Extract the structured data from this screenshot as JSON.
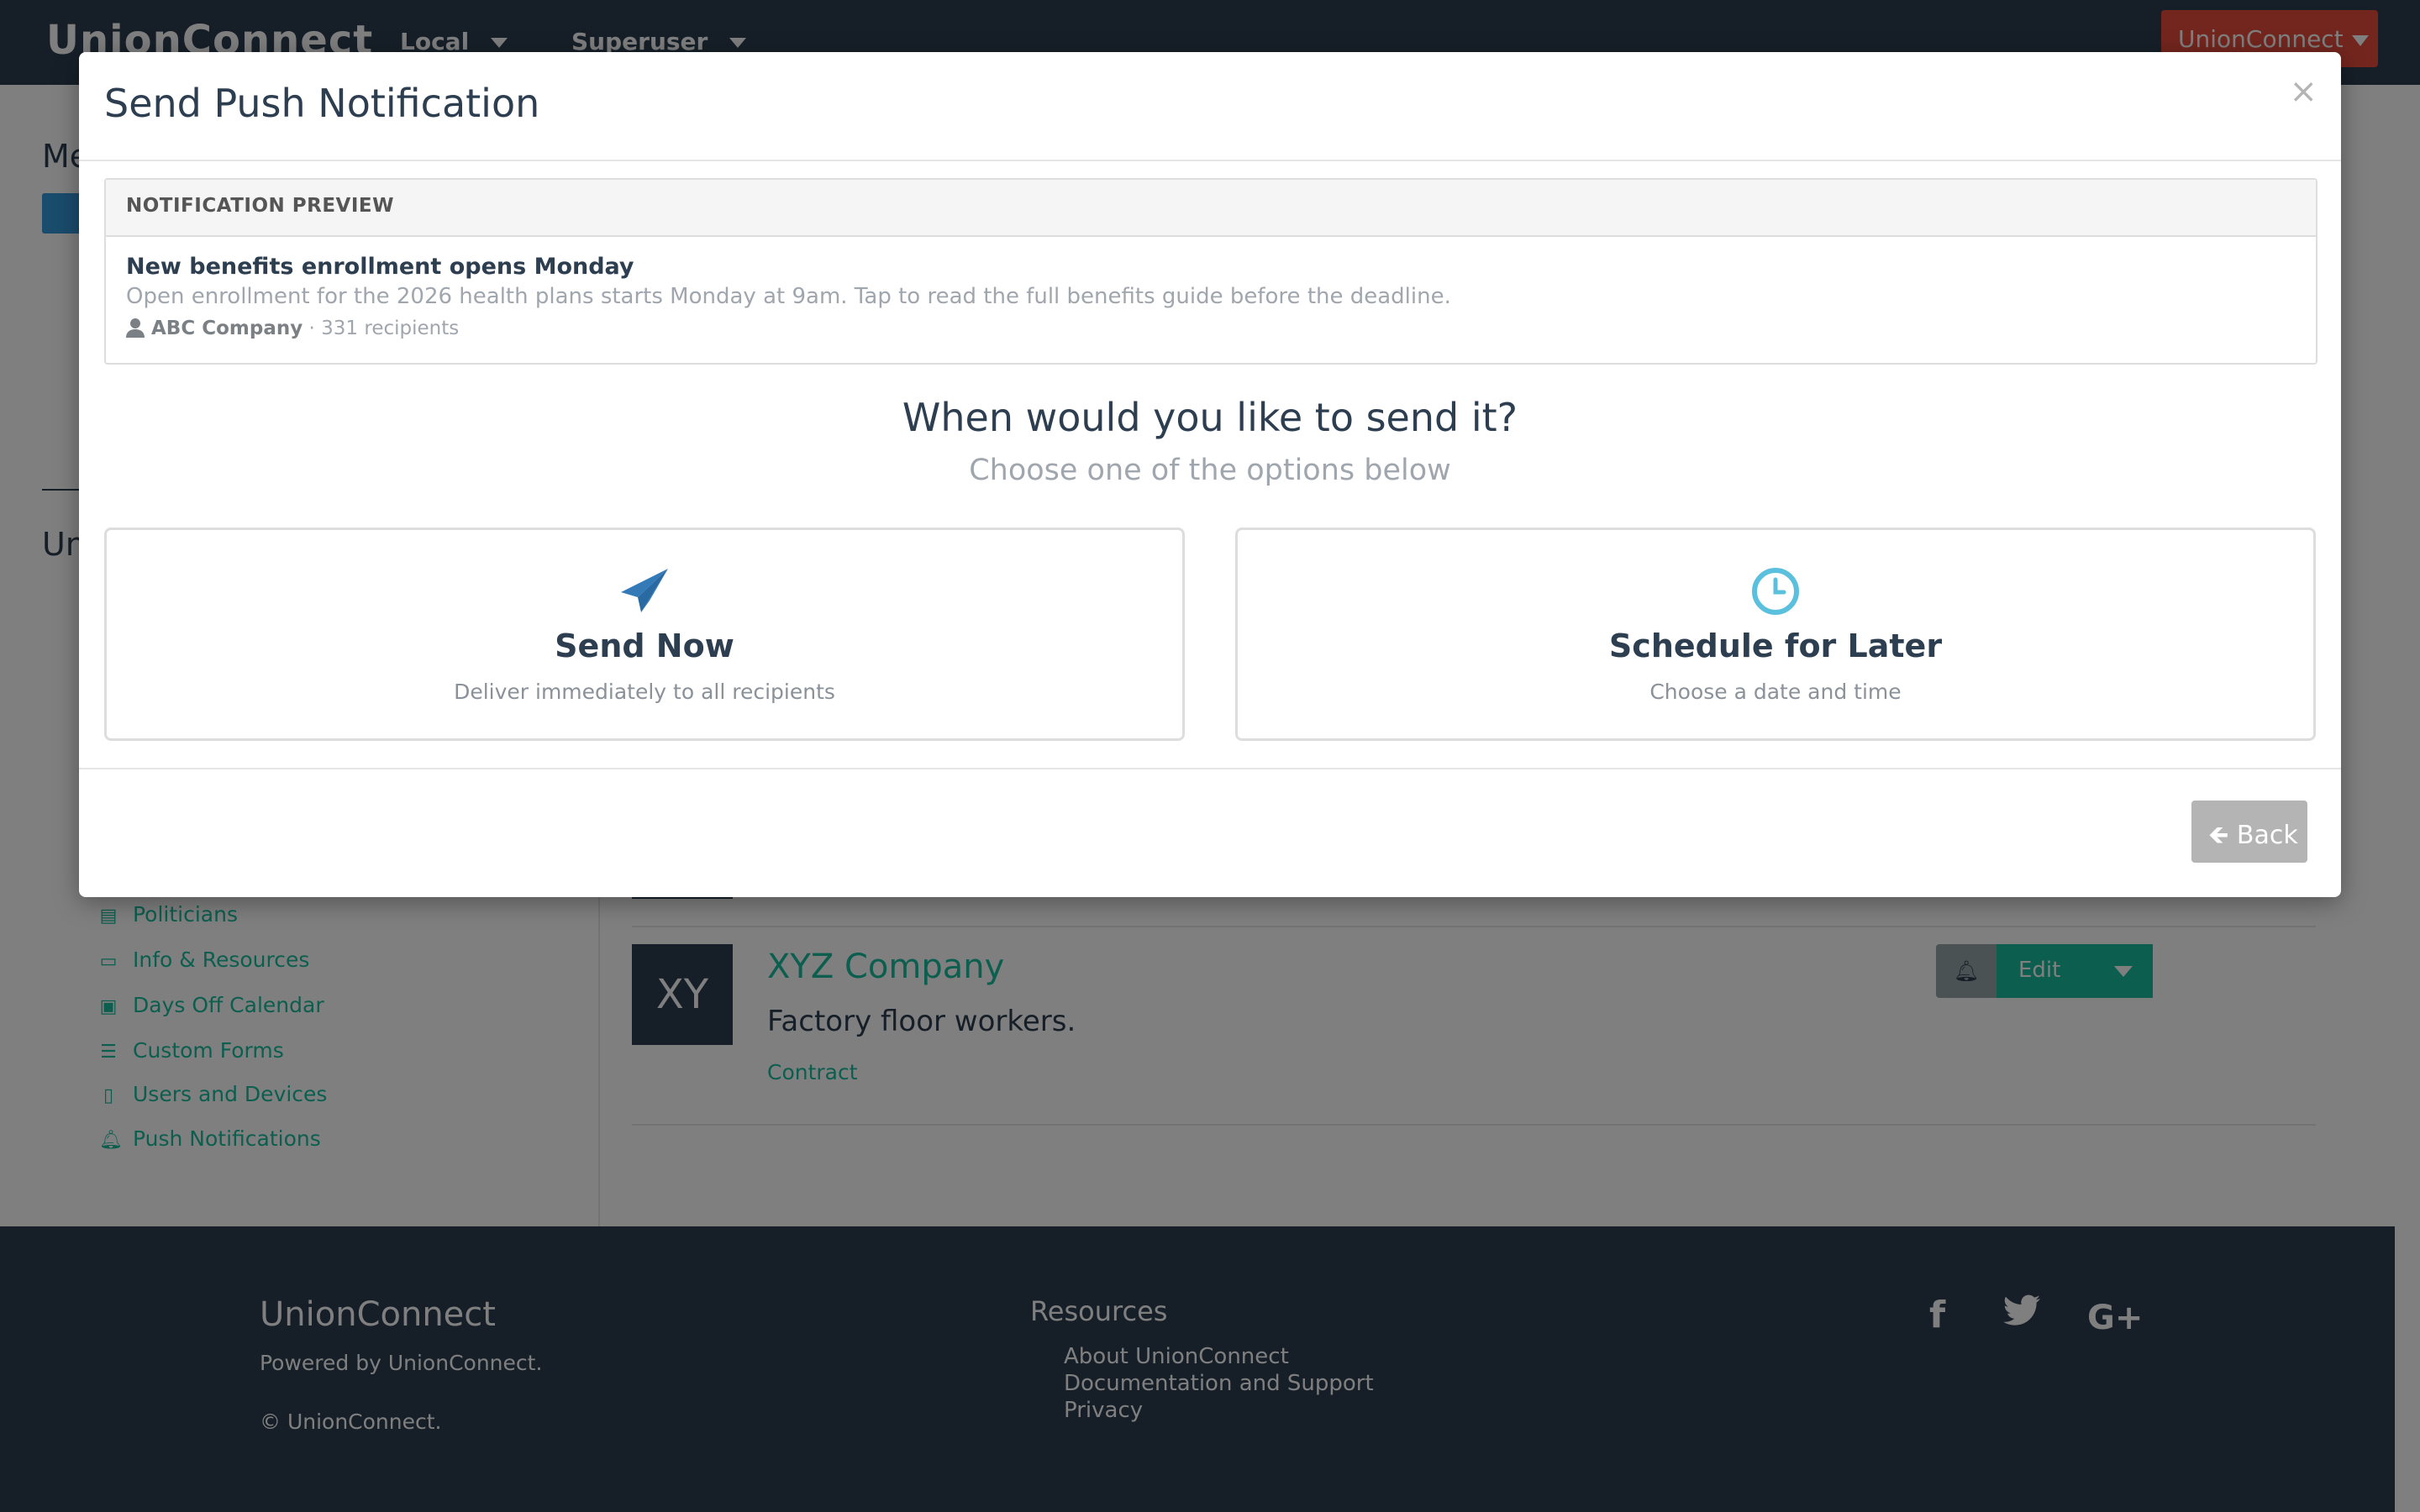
{
  "navbar": {
    "brand": "UnionConnect",
    "local_label": "Local",
    "superuser_label": "Superuser",
    "account_label": "UnionConnect"
  },
  "sidebar": {
    "heading_1": "Me",
    "heading_2": "Un",
    "items": [
      {
        "label": "Politicians",
        "icon": "building-icon"
      },
      {
        "label": "Info & Resources",
        "icon": "folder-open-icon"
      },
      {
        "label": "Days Off Calendar",
        "icon": "calendar-icon"
      },
      {
        "label": "Custom Forms",
        "icon": "list-icon"
      },
      {
        "label": "Users and Devices",
        "icon": "tablet-icon"
      },
      {
        "label": "Push Notifications",
        "icon": "bell-icon"
      }
    ]
  },
  "company": {
    "avatar": "XY",
    "name": "XYZ Company",
    "description": "Factory floor workers.",
    "tag": "Contract",
    "edit_label": "Edit"
  },
  "footer": {
    "brand": "UnionConnect",
    "powered": "Powered by UnionConnect.",
    "copyright": "© UnionConnect.",
    "resources_title": "Resources",
    "links": [
      "About UnionConnect",
      "Documentation and Support",
      "Privacy"
    ],
    "social": [
      "f",
      "twitter",
      "G+"
    ]
  },
  "modal": {
    "title": "Send Push Notification",
    "close": "×",
    "preview": {
      "header": "NOTIFICATION PREVIEW",
      "title": "New benefits enrollment opens Monday",
      "body": "Open enrollment for the 2026 health plans starts Monday at 9am. Tap to read the full benefits guide before the deadline.",
      "audience": "ABC Company",
      "recipients": "· 331 recipients"
    },
    "question": "When would you like to send it?",
    "subtitle": "Choose one of the options below",
    "options": [
      {
        "label": "Send Now",
        "desc": "Deliver immediately to all recipients",
        "icon": "paper-plane-icon",
        "color": "#337ab7"
      },
      {
        "label": "Schedule for Later",
        "desc": "Choose a date and time",
        "icon": "clock-icon",
        "color": "#5bc0de"
      }
    ],
    "back_label": "Back"
  },
  "colors": {
    "navy": "#2c3e50",
    "teal": "#18bc9c",
    "danger": "#e74c3c",
    "muted": "#b4b4b4"
  }
}
